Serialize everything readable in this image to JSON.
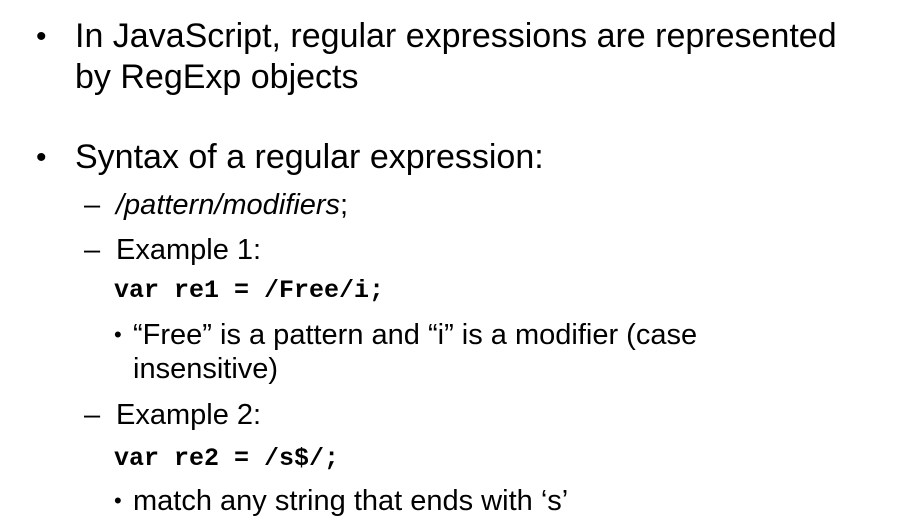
{
  "bullets": {
    "b1": {
      "marker": "•",
      "line1": "In JavaScript, regular expressions are represented",
      "line2": "by RegExp objects"
    },
    "b2": {
      "marker": "•",
      "text": "Syntax of a regular expression:"
    }
  },
  "sub": {
    "dash": "–",
    "syntax_italic": "/pattern/modifiers",
    "syntax_tail": ";",
    "ex1_label": "Example 1:",
    "ex1_code": "var re1 = /Free/i;",
    "ex1_note_marker": "•",
    "ex1_note_line1": "“Free” is a pattern and “i” is a modifier (case",
    "ex1_note_line2": "insensitive)",
    "ex2_label": "Example 2:",
    "ex2_code": "var re2 = /s$/;",
    "ex2_note_marker": "•",
    "ex2_note": "match any string that ends with ‘s’"
  }
}
